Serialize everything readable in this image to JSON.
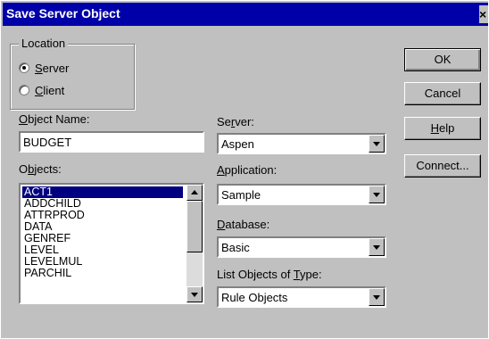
{
  "window": {
    "title": "Save Server Object",
    "close_glyph": "×"
  },
  "location": {
    "group_label": "Location",
    "options": [
      {
        "label_prefix": "",
        "label_mnemonic": "S",
        "label_rest": "erver",
        "selected": true
      },
      {
        "label_prefix": "",
        "label_mnemonic": "C",
        "label_rest": "lient",
        "selected": false
      }
    ]
  },
  "object_name": {
    "label_mnemonic": "O",
    "label_rest": "bject Name:",
    "value": "BUDGET"
  },
  "objects": {
    "label_prefix": "O",
    "label_mnemonic": "b",
    "label_rest": "jects:",
    "items": [
      "ACT1",
      "ADDCHILD",
      "ATTRPROD",
      "DATA",
      "GENREF",
      "LEVEL",
      "LEVELMUL",
      "PARCHIL"
    ],
    "selected_index": 0
  },
  "server": {
    "label_prefix": "Se",
    "label_mnemonic": "r",
    "label_rest": "ver:",
    "value": "Aspen"
  },
  "application": {
    "label_prefix": "",
    "label_mnemonic": "A",
    "label_rest": "pplication:",
    "value": "Sample"
  },
  "database": {
    "label_prefix": "",
    "label_mnemonic": "D",
    "label_rest": "atabase:",
    "value": "Basic"
  },
  "list_type": {
    "label_prefix": "List Objects of ",
    "label_mnemonic": "T",
    "label_rest": "ype:",
    "value": "Rule Objects"
  },
  "buttons": {
    "ok": "OK",
    "cancel": "Cancel",
    "help_mnemonic": "H",
    "help_rest": "elp",
    "connect": "Connect..."
  }
}
